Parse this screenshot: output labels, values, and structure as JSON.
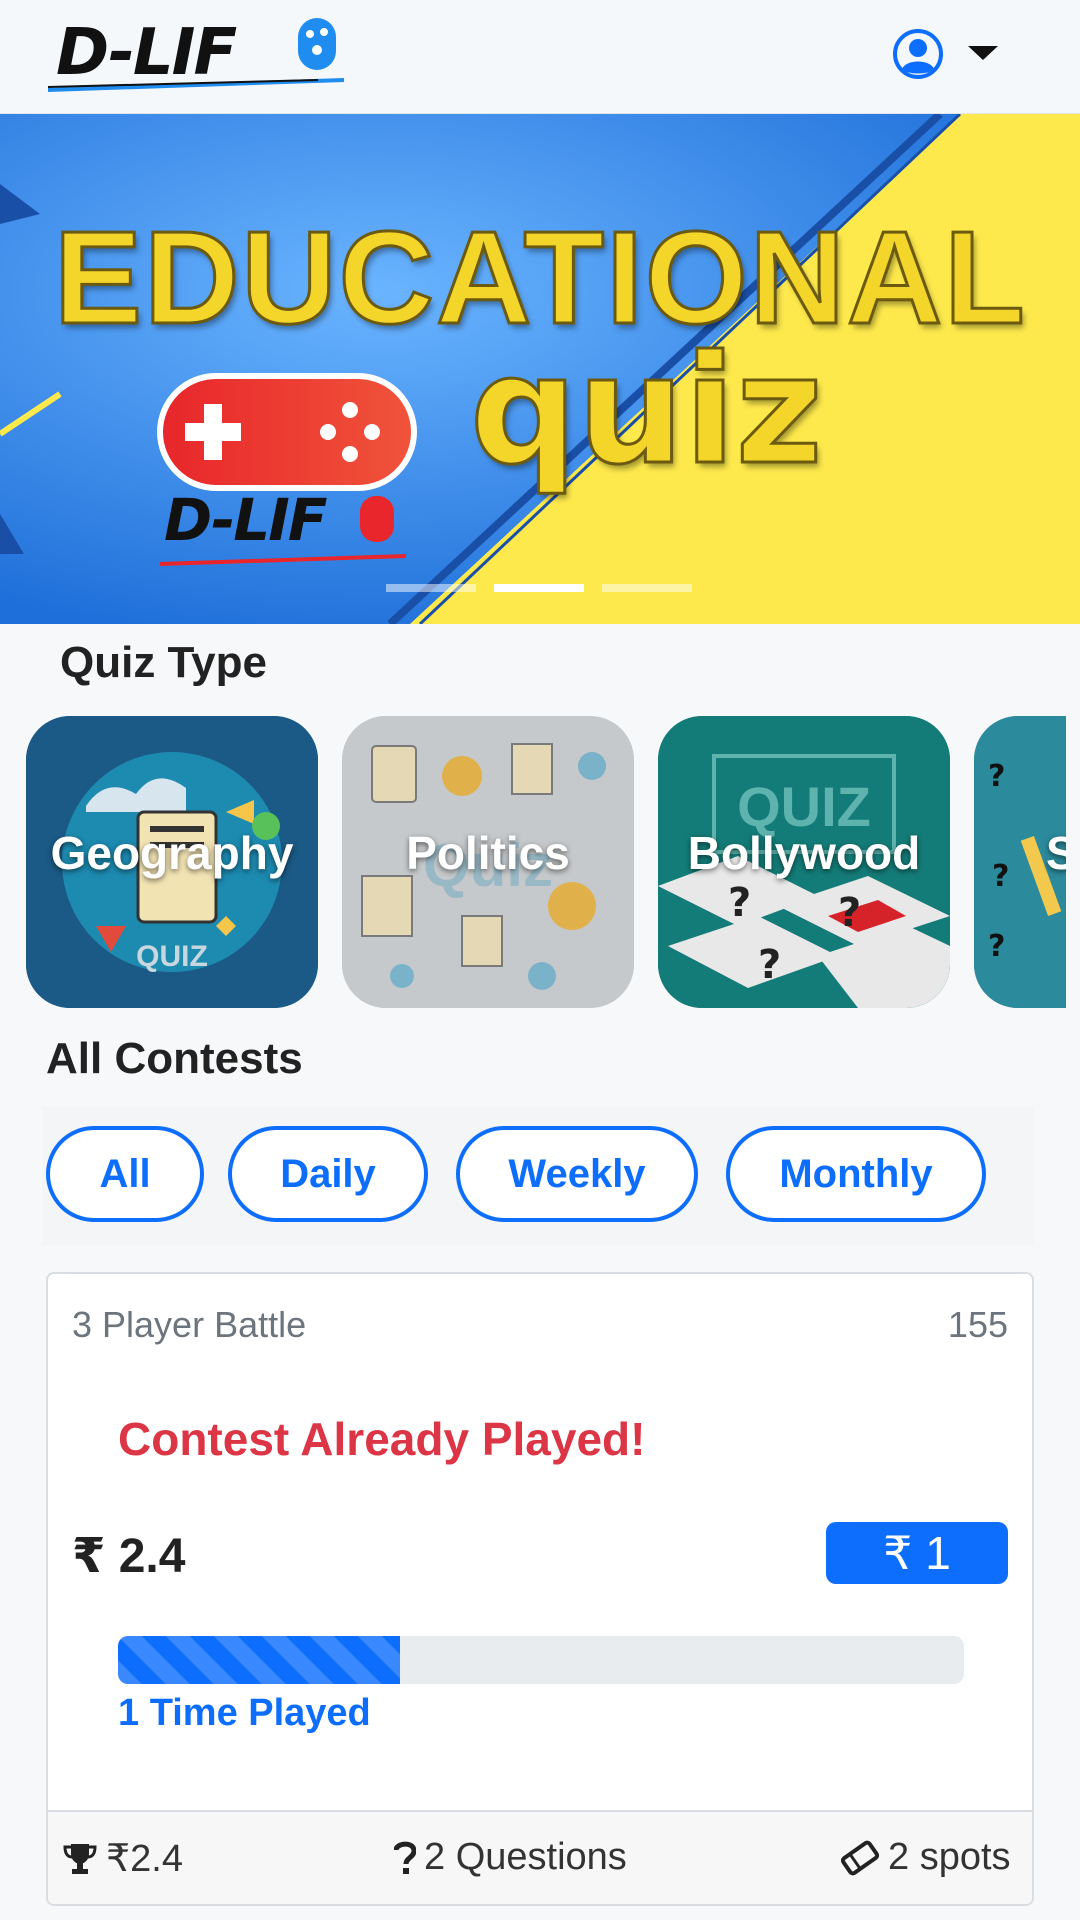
{
  "header": {
    "logo_text": "D-LIF",
    "user_icon": "user-circle-icon",
    "caret_icon": "caret-down-icon"
  },
  "banner": {
    "title": "EDUCATIONAL",
    "subtitle": "quiz",
    "logo_text": "D-LIF",
    "slides": 3,
    "active_slide": 2
  },
  "quiz_type": {
    "title": "Quiz Type",
    "items": [
      {
        "label": "Geography"
      },
      {
        "label": "Politics"
      },
      {
        "label": "Bollywood"
      },
      {
        "label": "S"
      }
    ]
  },
  "contests": {
    "title": "All Contests",
    "filters": [
      "All",
      "Daily",
      "Weekly",
      "Monthly"
    ]
  },
  "card": {
    "type": "3 Player Battle",
    "count": "155",
    "status": "Contest Already Played!",
    "prize": "₹ 2.4",
    "entry_fee": "₹ 1",
    "progress_fraction": 0.333,
    "progress_label": "1 Time Played",
    "footer": {
      "prize": "₹2.4",
      "questions": "2 Questions",
      "spots": "2 spots"
    }
  },
  "colors": {
    "primary": "#0d6efd",
    "danger": "#dc3545",
    "banner_blue": "#1e6fd9",
    "banner_yellow": "#fde94c"
  }
}
